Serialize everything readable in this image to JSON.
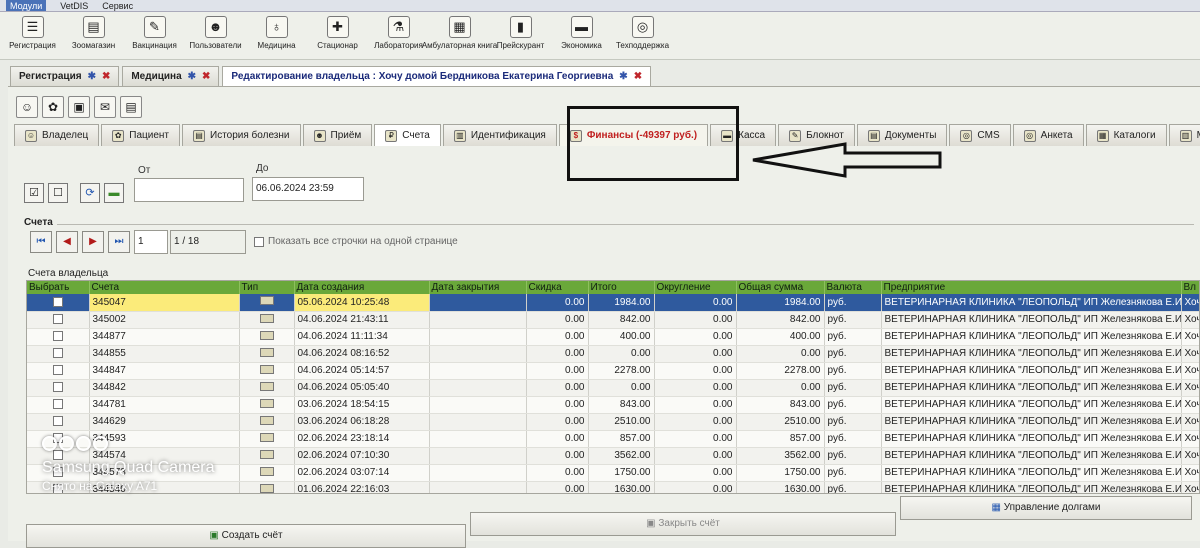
{
  "menu": [
    "Модули",
    "VetDIS",
    "Сервис"
  ],
  "toolbar": [
    {
      "label": "Регистрация",
      "icon": "registration-icon",
      "glyph": "☰"
    },
    {
      "label": "Зоомагазин",
      "icon": "shop-icon",
      "glyph": "▤"
    },
    {
      "label": "Вакцинация",
      "icon": "syringe-icon",
      "glyph": "✎"
    },
    {
      "label": "Пользователи",
      "icon": "users-icon",
      "glyph": "☻"
    },
    {
      "label": "Медицина",
      "icon": "stethoscope-icon",
      "glyph": "♁"
    },
    {
      "label": "Стационар",
      "icon": "hospital-icon",
      "glyph": "✚"
    },
    {
      "label": "Лаборатория",
      "icon": "flask-icon",
      "glyph": "⚗"
    },
    {
      "label": "Амбулаторная книга",
      "icon": "book-icon",
      "glyph": "▦"
    },
    {
      "label": "Прейскурант",
      "icon": "price-list-icon",
      "glyph": "▮"
    },
    {
      "label": "Экономика",
      "icon": "money-icon",
      "glyph": "▬"
    },
    {
      "label": "Техподдержка",
      "icon": "support-icon",
      "glyph": "◎"
    }
  ],
  "doc_tabs": [
    {
      "label": "Регистрация"
    },
    {
      "label": "Медицина"
    },
    {
      "label": "Редактирование владельца : Хочу домой Бердникова Екатерина Георгиевна"
    }
  ],
  "section_tabs": [
    {
      "label": "Владелец"
    },
    {
      "label": "Пациент"
    },
    {
      "label": "История болезни"
    },
    {
      "label": "Приём"
    },
    {
      "label": "Счета"
    },
    {
      "label": "Идентификация"
    },
    {
      "label": "Финансы (-49397 руб.)"
    },
    {
      "label": "Касса"
    },
    {
      "label": "Блокнот"
    },
    {
      "label": "Документы"
    },
    {
      "label": "CMS"
    },
    {
      "label": "Анкета"
    },
    {
      "label": "Каталоги"
    },
    {
      "label": "М"
    }
  ],
  "filter": {
    "from_label": "От",
    "to_label": "До",
    "from_value": "",
    "to_value": "06.06.2024 23:59"
  },
  "accounts": {
    "title": "Счета",
    "page_input": "1",
    "page_total": "1 / 18",
    "show_all_label": "Показать все строчки на одной странице",
    "owner_accounts_label": "Счета владельца"
  },
  "table": {
    "headers": [
      "Выбрать",
      "Счета",
      "Тип",
      "Дата создания",
      "Дата закрытия",
      "Скидка",
      "Итого",
      "Округление",
      "Общая сумма",
      "Валюта",
      "Предприятие",
      "Вл"
    ],
    "rows": [
      {
        "id": "345047",
        "created": "05.06.2024 10:25:48",
        "discount": "0.00",
        "total": "1984.00",
        "rounding": "0.00",
        "sum": "1984.00",
        "currency": "руб.",
        "org": "ВЕТЕРИНАРНАЯ КЛИНИКА \"ЛЕОПОЛЬД\" ИП Железнякова Е.И.",
        "owner": "Хоч"
      },
      {
        "id": "345002",
        "created": "04.06.2024 21:43:11",
        "discount": "0.00",
        "total": "842.00",
        "rounding": "0.00",
        "sum": "842.00",
        "currency": "руб.",
        "org": "ВЕТЕРИНАРНАЯ КЛИНИКА \"ЛЕОПОЛЬД\" ИП Железнякова Е.И.",
        "owner": "Хоч"
      },
      {
        "id": "344877",
        "created": "04.06.2024 11:11:34",
        "discount": "0.00",
        "total": "400.00",
        "rounding": "0.00",
        "sum": "400.00",
        "currency": "руб.",
        "org": "ВЕТЕРИНАРНАЯ КЛИНИКА \"ЛЕОПОЛЬД\" ИП Железнякова Е.И.",
        "owner": "Хоч"
      },
      {
        "id": "344855",
        "created": "04.06.2024 08:16:52",
        "discount": "0.00",
        "total": "0.00",
        "rounding": "0.00",
        "sum": "0.00",
        "currency": "руб.",
        "org": "ВЕТЕРИНАРНАЯ КЛИНИКА \"ЛЕОПОЛЬД\" ИП Железнякова Е.И.",
        "owner": "Хоч"
      },
      {
        "id": "344847",
        "created": "04.06.2024 05:14:57",
        "discount": "0.00",
        "total": "2278.00",
        "rounding": "0.00",
        "sum": "2278.00",
        "currency": "руб.",
        "org": "ВЕТЕРИНАРНАЯ КЛИНИКА \"ЛЕОПОЛЬД\" ИП Железнякова Е.И.",
        "owner": "Хоч"
      },
      {
        "id": "344842",
        "created": "04.06.2024 05:05:40",
        "discount": "0.00",
        "total": "0.00",
        "rounding": "0.00",
        "sum": "0.00",
        "currency": "руб.",
        "org": "ВЕТЕРИНАРНАЯ КЛИНИКА \"ЛЕОПОЛЬД\" ИП Железнякова Е.И.",
        "owner": "Хоч"
      },
      {
        "id": "344781",
        "created": "03.06.2024 18:54:15",
        "discount": "0.00",
        "total": "843.00",
        "rounding": "0.00",
        "sum": "843.00",
        "currency": "руб.",
        "org": "ВЕТЕРИНАРНАЯ КЛИНИКА \"ЛЕОПОЛЬД\" ИП Железнякова Е.И.",
        "owner": "Хоч"
      },
      {
        "id": "344629",
        "created": "03.06.2024 06:18:28",
        "discount": "0.00",
        "total": "2510.00",
        "rounding": "0.00",
        "sum": "2510.00",
        "currency": "руб.",
        "org": "ВЕТЕРИНАРНАЯ КЛИНИКА \"ЛЕОПОЛЬД\" ИП Железнякова Е.И.",
        "owner": "Хоч"
      },
      {
        "id": "344593",
        "created": "02.06.2024 23:18:14",
        "discount": "0.00",
        "total": "857.00",
        "rounding": "0.00",
        "sum": "857.00",
        "currency": "руб.",
        "org": "ВЕТЕРИНАРНАЯ КЛИНИКА \"ЛЕОПОЛЬД\" ИП Железнякова Е.И.",
        "owner": "Хоч"
      },
      {
        "id": "344574",
        "created": "02.06.2024 07:10:30",
        "discount": "0.00",
        "total": "3562.00",
        "rounding": "0.00",
        "sum": "3562.00",
        "currency": "руб.",
        "org": "ВЕТЕРИНАРНАЯ КЛИНИКА \"ЛЕОПОЛЬД\" ИП Железнякова Е.И.",
        "owner": "Хоч"
      },
      {
        "id": "344573",
        "created": "02.06.2024 03:07:14",
        "discount": "0.00",
        "total": "1750.00",
        "rounding": "0.00",
        "sum": "1750.00",
        "currency": "руб.",
        "org": "ВЕТЕРИНАРНАЯ КЛИНИКА \"ЛЕОПОЛЬД\" ИП Железнякова Е.И.",
        "owner": "Хоч"
      },
      {
        "id": "344540",
        "created": "01.06.2024 22:16:03",
        "discount": "0.00",
        "total": "1630.00",
        "rounding": "0.00",
        "sum": "1630.00",
        "currency": "руб.",
        "org": "ВЕТЕРИНАРНАЯ КЛИНИКА \"ЛЕОПОЛЬД\" ИП Железнякова Е.И.",
        "owner": "Хоч"
      }
    ],
    "selected_index": 0
  },
  "footer": {
    "create_label": "Создать счёт",
    "close_label": "Закрыть счёт",
    "debt_label": "Управление долгами"
  },
  "watermark": {
    "line1": "Samsung Quad Camera",
    "line2": "Снято на Galaxy A71"
  },
  "colors": {
    "header_green": "#6aa83a",
    "selected_row": "#2f5a9e",
    "finance_red": "#c02020",
    "highlight_yellow": "#fbeb7a"
  }
}
